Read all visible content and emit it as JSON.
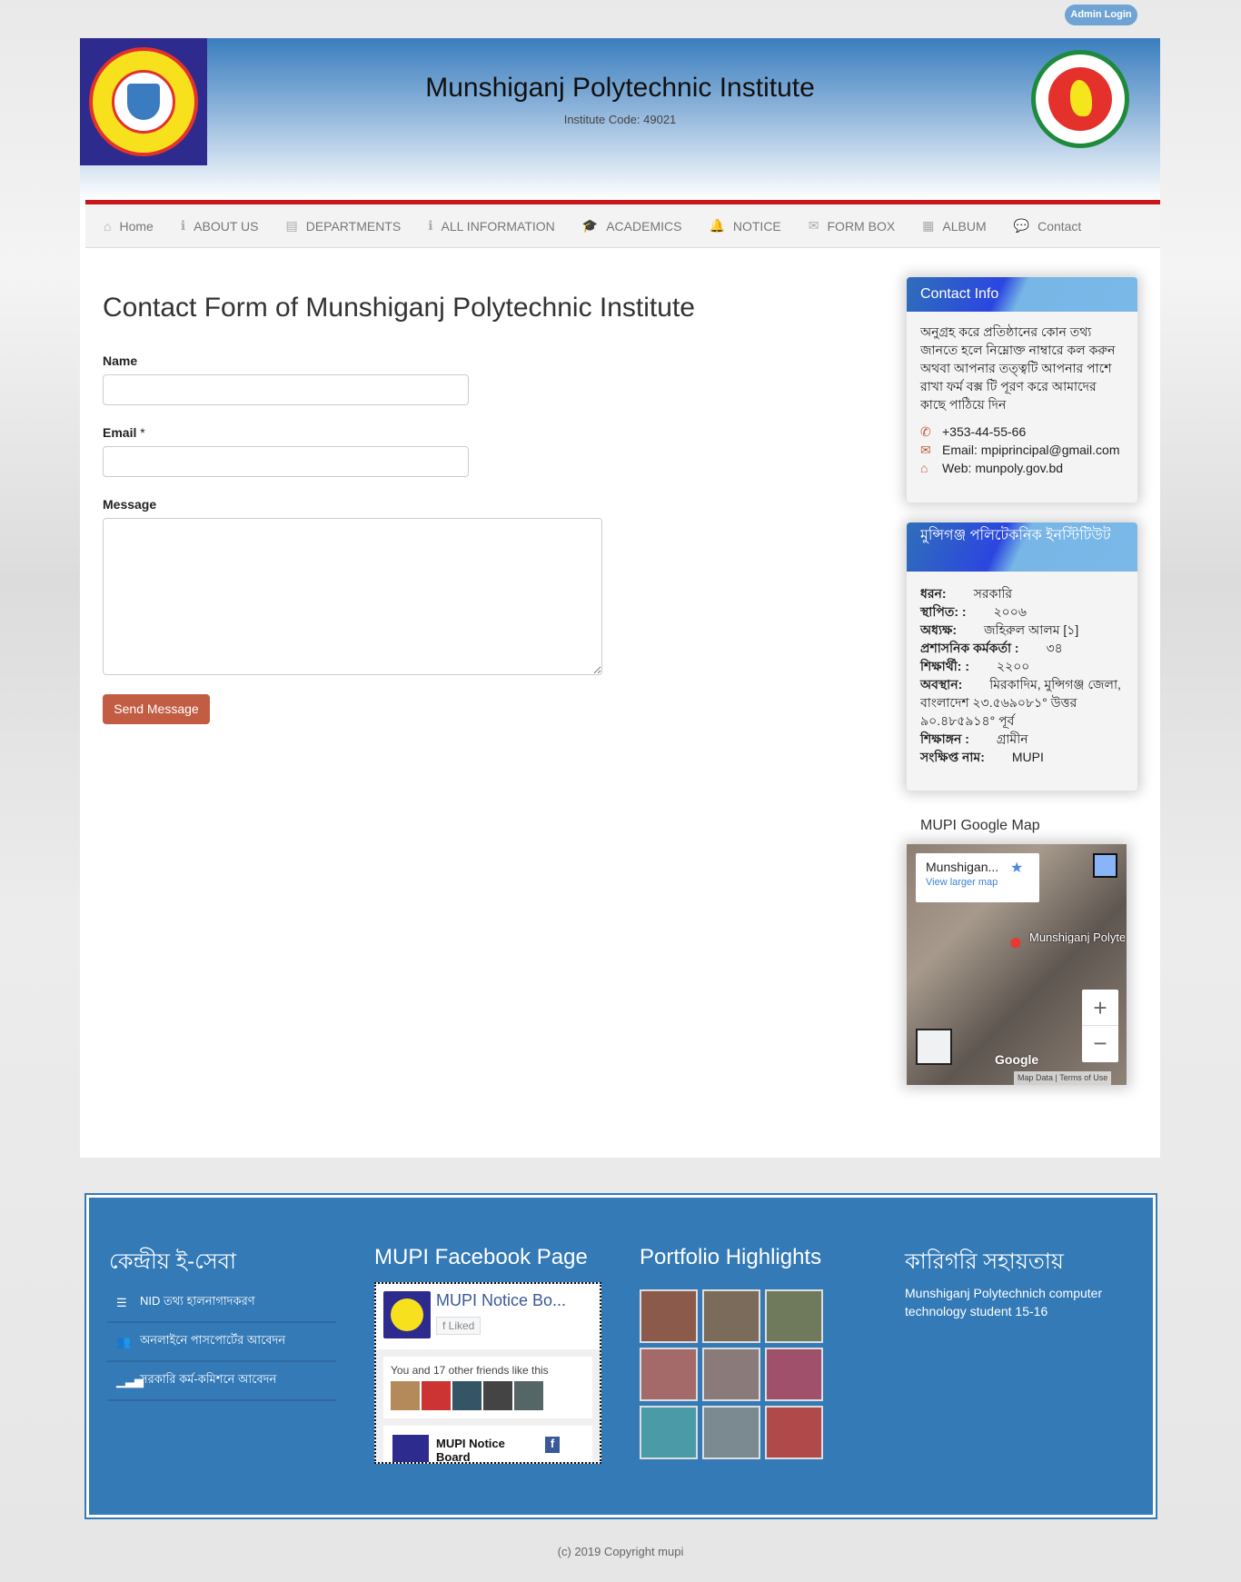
{
  "top": {
    "admin_login": "Admin Login"
  },
  "header": {
    "title": "Munshiganj Polytechnic Institute",
    "code": "Institute Code: 49021"
  },
  "nav": [
    {
      "label": "Home",
      "icon": "home-icon",
      "glyph": "⌂"
    },
    {
      "label": "ABOUT US",
      "icon": "info-icon",
      "glyph": "ℹ"
    },
    {
      "label": "DEPARTMENTS",
      "icon": "book-icon",
      "glyph": "▤"
    },
    {
      "label": "ALL INFORMATION",
      "icon": "info-icon",
      "glyph": "ℹ"
    },
    {
      "label": "ACADEMICS",
      "icon": "graduation-cap-icon",
      "glyph": "🎓"
    },
    {
      "label": "NOTICE",
      "icon": "bell-icon",
      "glyph": "🔔"
    },
    {
      "label": "FORM BOX",
      "icon": "envelope-icon",
      "glyph": "✉"
    },
    {
      "label": "ALBUM",
      "icon": "grid-icon",
      "glyph": "▦"
    },
    {
      "label": "Contact",
      "icon": "comment-icon",
      "glyph": "💬"
    }
  ],
  "form": {
    "title": "Contact Form of Munshiganj Polytechnic Institute",
    "name_label": "Name",
    "email_label": "Email",
    "required_mark": "*",
    "message_label": "Message",
    "name_value": "",
    "email_value": "",
    "message_value": "",
    "send": "Send Message"
  },
  "contact": {
    "title": "Contact Info",
    "text": "অনুগ্রহ করে প্রতিষ্ঠানের কোন তথ্য জানতে হলে নিম্নোক্ত নাম্বারে কল করুন অথবা আপনার তত্ত্বটি আপনার পাশে রাখা ফর্ম বক্স টি পূরণ করে আমাদের কাছে পাঠিয়ে দিন",
    "phone": "+353-44-55-66",
    "email": "Email: mpiprincipal@gmail.com",
    "web": "Web: munpoly.gov.bd",
    "accent": "#c05a3e"
  },
  "info": {
    "title": "মুন্সিগঞ্জ পলিটেকনিক ইনস্টিটিউট",
    "rows": [
      {
        "k": "ধরন:",
        "v": "সরকারি"
      },
      {
        "k": "স্থাপিত: :",
        "v": "২০০৬"
      },
      {
        "k": "অধ্যক্ষ:",
        "v": "জহিরুল আলম [১]"
      },
      {
        "k": "প্রশাসনিক কর্মকর্তা :",
        "v": "৩৪"
      },
      {
        "k": "শিক্ষার্থী: :",
        "v": "২২০০"
      },
      {
        "k": "অবস্থান:",
        "v": "মিরকাদিম, মুন্সিগঞ্জ জেলা, বাংলাদেশ ২৩.৫৬৯০৮১° উত্তর ৯০.৪৮৫৯১৪° পূর্ব"
      },
      {
        "k": "শিক্ষাঙ্গন :",
        "v": "গ্রামীন"
      },
      {
        "k": "সংক্ষিপ্ত নাম:",
        "v": "MUPI"
      }
    ]
  },
  "map": {
    "heading": "MUPI Google Map",
    "place": "Munshigan...",
    "view_larger": "View larger map",
    "pin_label": "Munshiganj Polytechnic Instit",
    "google": "Google",
    "map_data": "Map Data",
    "terms": "Terms of Use",
    "zoom_in": "+",
    "zoom_out": "−"
  },
  "footer": {
    "col1": {
      "title": "কেন্দ্রীয় ই-সেবা",
      "items": [
        {
          "label": "NID তথ্য হালনাগাদকরণ",
          "icon": "server-icon"
        },
        {
          "label": "অনলাইনে পাসপোর্টের আবেদন",
          "icon": "users-icon"
        },
        {
          "label": "সরকারি কর্ম-কমিশনে আবেদন",
          "icon": "signal-icon"
        }
      ]
    },
    "col2": {
      "title": "MUPI Facebook Page",
      "page_name": "MUPI Notice Bo...",
      "liked": "Liked",
      "friends": "You and 17 other friends like this",
      "post_name": "MUPI Notice Board"
    },
    "col3": {
      "title": "Portfolio Highlights"
    },
    "col4": {
      "title": "কারিগরি সহায়তায়",
      "text": "Munshiganj Polytechnich computer technology student 15-16"
    }
  },
  "copyright": "(c) 2019 Copyright mupi"
}
